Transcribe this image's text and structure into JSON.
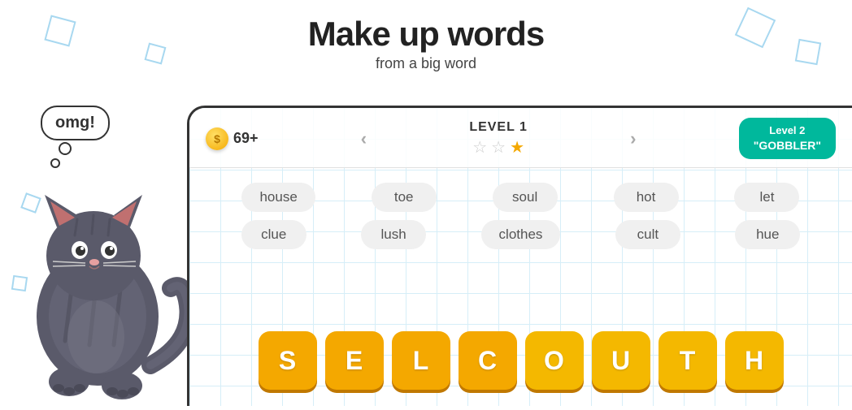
{
  "header": {
    "title": "Make up words",
    "subtitle": "from a big word"
  },
  "speech_bubble": {
    "text": "omg!"
  },
  "topbar": {
    "coins": "69+",
    "level_label": "LEVEL 1",
    "nav_left": "‹",
    "nav_right": "›",
    "next_level_num": "Level 2",
    "next_level_name": "\"GOBBLER\""
  },
  "stars": [
    {
      "filled": false
    },
    {
      "filled": false
    },
    {
      "filled": true
    }
  ],
  "words_row1": [
    "house",
    "toe",
    "soul",
    "hot",
    "let"
  ],
  "words_row2": [
    "clue",
    "lush",
    "clothes",
    "cult",
    "hue"
  ],
  "tiles": [
    {
      "letter": "S"
    },
    {
      "letter": "E"
    },
    {
      "letter": "L"
    },
    {
      "letter": "C"
    },
    {
      "letter": "O"
    },
    {
      "letter": "U"
    },
    {
      "letter": "T"
    },
    {
      "letter": "H"
    }
  ],
  "icons": {
    "coin": "$",
    "star_empty": "☆",
    "star_filled": "★"
  }
}
